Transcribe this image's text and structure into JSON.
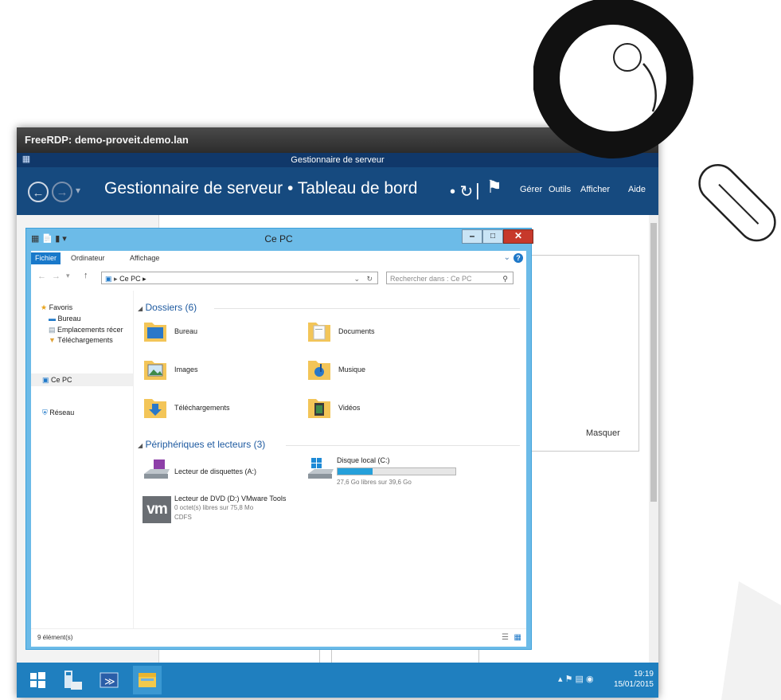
{
  "rdp": {
    "title": "FreeRDP: demo-proveit.demo.lan"
  },
  "server_manager": {
    "window_title": "Gestionnaire de serveur",
    "breadcrumb": "Gestionnaire de serveur • Tableau de bord",
    "menus": [
      "Gérer",
      "Outils",
      "Afficher",
      "Aide"
    ],
    "masquer": "Masquer"
  },
  "explorer": {
    "title": "Ce PC",
    "ribbon_tabs": [
      "Fichier",
      "Ordinateur",
      "Affichage"
    ],
    "address": "Ce PC ▸",
    "search_placeholder": "Rechercher dans : Ce PC",
    "nav": {
      "favoris": "Favoris",
      "bureau": "Bureau",
      "emplacements": "Emplacements récer",
      "telechargements": "Téléchargements",
      "ce_pc": "Ce PC",
      "reseau": "Réseau"
    },
    "folders_header": "Dossiers (6)",
    "folders": [
      "Bureau",
      "Documents",
      "Images",
      "Musique",
      "Téléchargements",
      "Vidéos"
    ],
    "devices_header": "Périphériques et lecteurs (3)",
    "devices": [
      {
        "name": "Lecteur de disquettes (A:)"
      },
      {
        "name": "Disque local (C:)",
        "detail": "27,6 Go libres sur 39,6 Go",
        "used_fraction": 0.3
      },
      {
        "name": "Lecteur de DVD (D:) VMware Tools",
        "detail": "0 octet(s) libres sur 75,8 Mo",
        "fs": "CDFS"
      }
    ],
    "status": "9 élément(s)"
  },
  "taskbar": {
    "time": "19:19",
    "date": "15/01/2015"
  },
  "colors": {
    "server_manager_header": "#164a7f",
    "taskbar": "#1f7fbf",
    "explorer_frame": "#6cbbe8",
    "close_button": "#c7392b"
  }
}
